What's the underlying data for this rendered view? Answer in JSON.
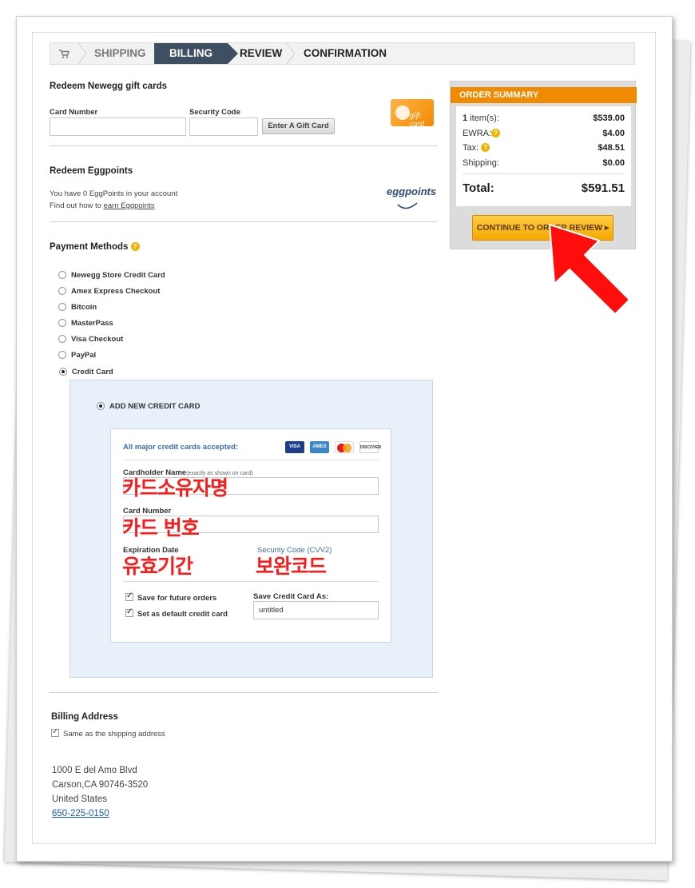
{
  "breadcrumb": {
    "steps": [
      {
        "label": "SHIPPING"
      },
      {
        "label": "BILLING"
      },
      {
        "label": "REVIEW"
      },
      {
        "label": "CONFIRMATION"
      }
    ]
  },
  "gift": {
    "heading": "Redeem Newegg gift cards",
    "card_number_label": "Card Number",
    "security_code_label": "Security Code",
    "button": "Enter A Gift Card",
    "logo_text": "gift card"
  },
  "eggpoints": {
    "heading": "Redeem Eggpoints",
    "balance_text": "You have 0 EggPoints in your account",
    "find_text": "Find out how to ",
    "find_link": "earn Eggpoints",
    "logo_text": "eggpoints"
  },
  "payment": {
    "heading": "Payment Methods",
    "methods": [
      {
        "label": "Newegg Store Credit Card"
      },
      {
        "label": "Amex Express Checkout"
      },
      {
        "label": "Bitcoin"
      },
      {
        "label": "MasterPass"
      },
      {
        "label": "Visa Checkout"
      },
      {
        "label": "PayPal"
      },
      {
        "label": "Credit Card"
      }
    ],
    "selected": "Credit Card"
  },
  "credit_card": {
    "add_new_label": "ADD NEW CREDIT CARD",
    "accepted_text": "All major credit cards accepted:",
    "card_logos": [
      "VISA",
      "AMEX",
      "MasterCard",
      "DISCOVER"
    ],
    "cardholder_label": "Cardholder Name",
    "cardholder_hint": "(exactly as shown on card)",
    "card_number_label": "Card Number",
    "expiration_label": "Expiration Date",
    "security_label": "Security Code (CVV2)",
    "save_future": "Save for future orders",
    "set_default": "Set as default credit card",
    "save_as_label": "Save Credit Card As:",
    "save_as_value": "untitled"
  },
  "annotations": {
    "cardholder": "카드소유자명",
    "card_number": "카드 번호",
    "expiration": "유효기간",
    "security": "보완코드"
  },
  "billing": {
    "heading": "Billing Address",
    "same_as_shipping": "Same as the shipping address",
    "address_line1": "1000 E del Amo Blvd",
    "address_line2": "Carson,CA 90746-3520",
    "country": "United States",
    "phone": "650-225-0150"
  },
  "order_summary": {
    "title": "ORDER SUMMARY",
    "items_count": "1",
    "items_label": " item(s):",
    "items_value": "$539.00",
    "ewra_label": "EWRA:",
    "ewra_value": "$4.00",
    "tax_label": "Tax:",
    "tax_value": "$48.51",
    "shipping_label": "Shipping:",
    "shipping_value": "$0.00",
    "total_label": "Total:",
    "total_value": "$591.51",
    "continue_button": "CONTINUE TO ORDER REVIEW ▸"
  },
  "colors": {
    "active_step": "#3e4f63",
    "summary_header": "#f08a00",
    "annotation_red": "#ff1a1a",
    "link_blue": "#1a5bb0"
  }
}
